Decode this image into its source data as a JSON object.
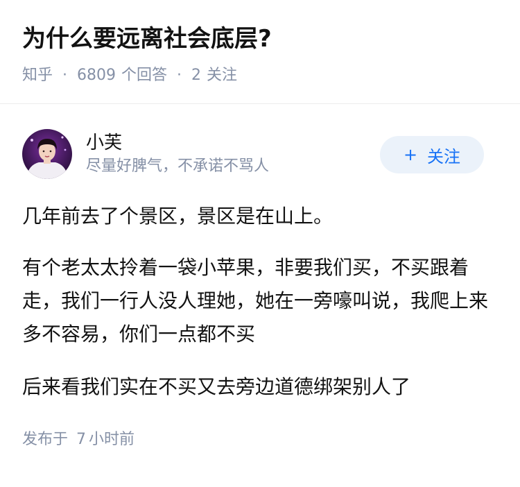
{
  "question": {
    "title": "为什么要远离社会底层?",
    "source": "知乎",
    "answer_count": "6809",
    "answer_label": "个回答",
    "follower_count": "2",
    "follower_label": "关注",
    "separator": "·"
  },
  "answer": {
    "author": {
      "name": "小芙",
      "headline": "尽量好脾气，不承诺不骂人"
    },
    "follow_button": {
      "plus": "+",
      "label": "关注"
    },
    "paragraphs": [
      "几年前去了个景区，景区是在山上。",
      "有个老太太拎着一袋小苹果，非要我们买，不买跟着走，我们一行人没人理她，她在一旁嚎叫说，我爬上来多不容易，你们一点都不买",
      "后来看我们实在不买又去旁边道德绑架别人了"
    ],
    "publish": {
      "label": "发布于",
      "amount": "7",
      "unit": "小时前"
    }
  },
  "colors": {
    "accent": "#1772f6",
    "button_bg": "#ebf2fa",
    "meta_text": "#8590a6",
    "main_text": "#121212"
  }
}
